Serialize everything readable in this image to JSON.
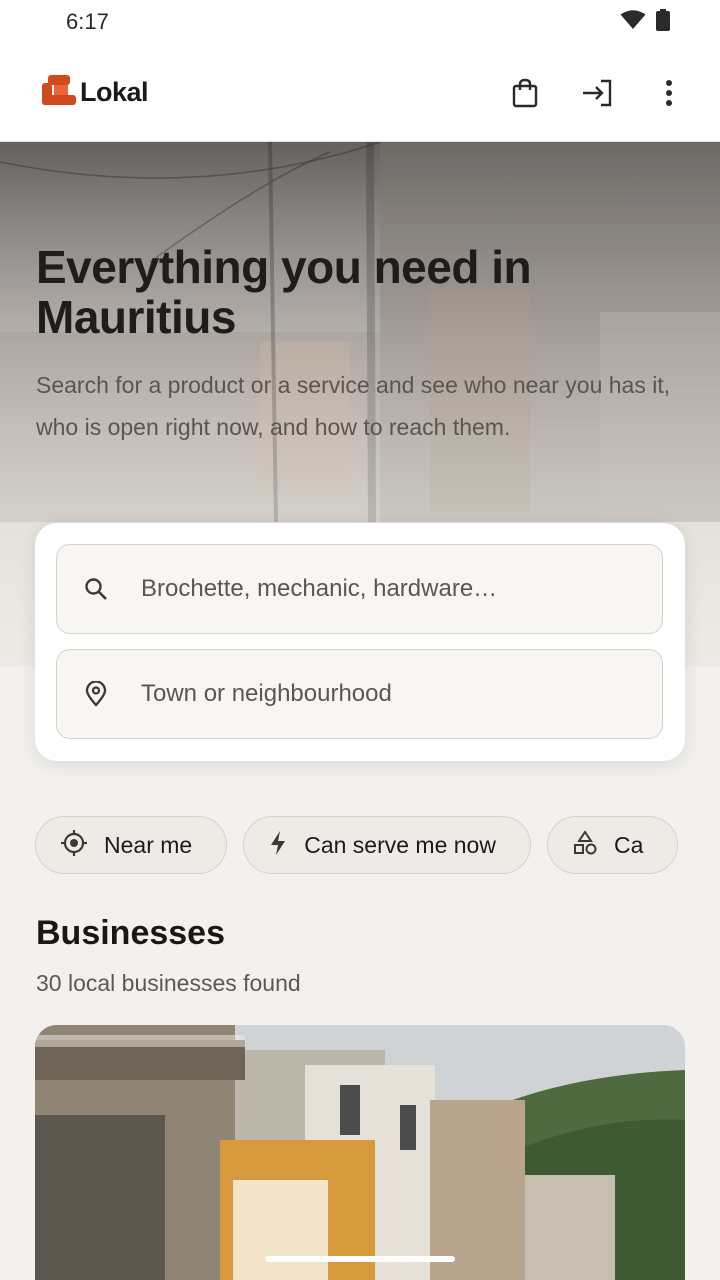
{
  "status_bar": {
    "time": "6:17",
    "icons": [
      "wifi-icon",
      "battery-icon"
    ]
  },
  "app_bar": {
    "logo_text": "Lokal",
    "actions": [
      "shopping-bag-icon",
      "sign-in-icon",
      "more-vert-icon"
    ],
    "brand_color": "#d2491c"
  },
  "hero": {
    "title": "Everything you need in Mauritius",
    "subtitle": "Search for a product or a service and see who near you has it, who is open right now, and how to reach them."
  },
  "search": {
    "query_placeholder": "Brochette, mechanic, hardware…",
    "location_placeholder": "Town or neighbourhood"
  },
  "chips": [
    {
      "icon": "crosshair-icon",
      "label": "Near me"
    },
    {
      "icon": "bolt-icon",
      "label": "Can serve me now"
    },
    {
      "icon": "categories-icon",
      "label": "Ca"
    }
  ],
  "businesses": {
    "title": "Businesses",
    "count_text": "30 local businesses found"
  }
}
